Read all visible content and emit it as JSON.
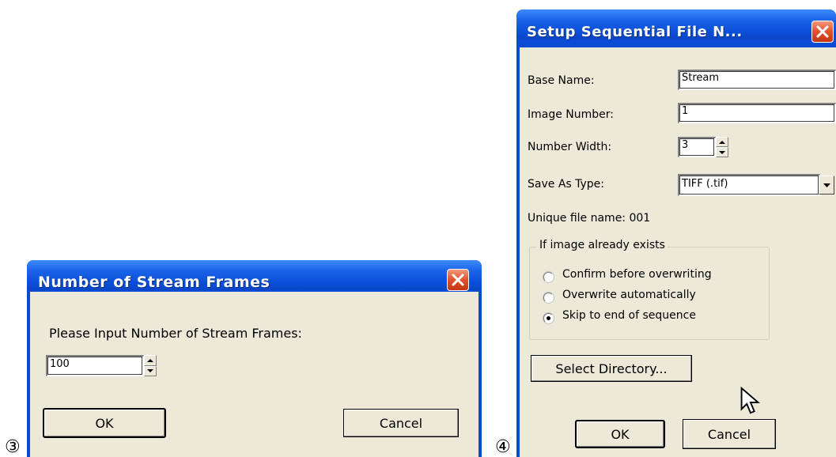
{
  "steps": {
    "left": "③",
    "right": "④"
  },
  "dialog_frames": {
    "title": "Number of Stream Frames",
    "prompt": "Please Input Number of Stream Frames:",
    "frames_value": "100",
    "ok_label": "OK",
    "cancel_label": "Cancel"
  },
  "dialog_seq": {
    "title": "Setup Sequential File N...",
    "base_name_label": "Base Name:",
    "base_name_value": "Stream",
    "image_number_label": "Image Number:",
    "image_number_value": "1",
    "number_width_label": "Number Width:",
    "number_width_value": "3",
    "save_as_type_label": "Save As Type:",
    "save_as_type_value": "TIFF (.tif)",
    "unique_file_name": "Unique file name: 001",
    "group_title": "If image already exists",
    "options": [
      {
        "label": "Confirm before overwriting",
        "selected": false
      },
      {
        "label": "Overwrite automatically",
        "selected": false
      },
      {
        "label": "Skip to end of sequence",
        "selected": true
      }
    ],
    "select_directory_label": "Select Directory...",
    "ok_label": "OK",
    "cancel_label": "Cancel"
  },
  "colors": {
    "titlebar": "#0b4ed8",
    "client": "#ece9d8",
    "close": "#e2512c"
  },
  "icons": [
    "close-icon",
    "spin-up-icon",
    "spin-down-icon",
    "dropdown-arrow-icon",
    "mouse-cursor-icon"
  ]
}
